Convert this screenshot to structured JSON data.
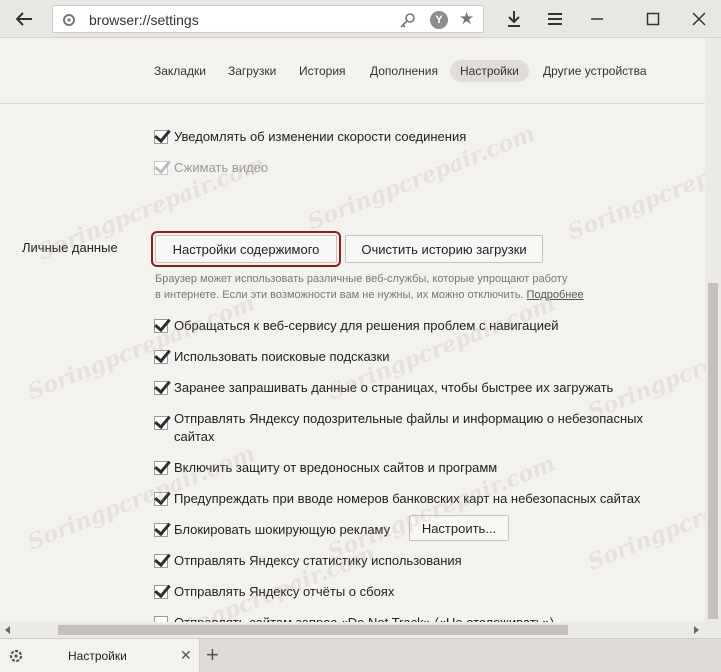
{
  "address_bar": {
    "url": "browser://settings",
    "yandex_badge": "Y"
  },
  "nav_tabs": [
    {
      "label": "Закладки"
    },
    {
      "label": "Загрузки"
    },
    {
      "label": "История"
    },
    {
      "label": "Дополнения"
    },
    {
      "label": "Настройки",
      "active": true
    },
    {
      "label": "Другие устройства"
    }
  ],
  "top_options": [
    {
      "label": "Уведомлять об изменении скорости соединения",
      "checked": true,
      "disabled": false
    },
    {
      "label": "Сжимать видео",
      "checked": true,
      "disabled": true
    }
  ],
  "personal_data": {
    "title": "Личные данные",
    "content_settings_button": "Настройки содержимого",
    "clear_history_button": "Очистить историю загрузки",
    "description_line1": "Браузер может использовать различные веб-службы, которые упрощают работу",
    "description_line2": "в интернете. Если эти возможности вам не нужны, их можно отключить.",
    "more_link": "Подробнее"
  },
  "options": [
    {
      "label": "Обращаться к веб-сервису для решения проблем с навигацией",
      "checked": true
    },
    {
      "label": "Использовать поисковые подсказки",
      "checked": true
    },
    {
      "label": "Заранее запрашивать данные о страницах, чтобы быстрее их загружать",
      "checked": true
    },
    {
      "label": "Отправлять Яндексу подозрительные файлы и информацию о небезопасных",
      "label2": "сайтах",
      "checked": true
    },
    {
      "label": "Включить защиту от вредоносных сайтов и программ",
      "checked": true
    },
    {
      "label": "Предупреждать при вводе номеров банковских карт на небезопасных сайтах",
      "checked": true
    },
    {
      "label": "Блокировать шокирующую рекламу",
      "checked": true,
      "button": "Настроить..."
    },
    {
      "label": "Отправлять Яндексу статистику использования",
      "checked": true
    },
    {
      "label": "Отправлять Яндексу отчёты о сбоях",
      "checked": true
    },
    {
      "label": "Отправлять сайтам запрос «Do Not Track» («Не отслеживать»)",
      "checked": false
    }
  ],
  "tab_strip": {
    "active_tab_title": "Настройки"
  },
  "watermark": "Soringpcrepair.com",
  "colors": {
    "highlight_outline": "#8a1f1f",
    "background": "#f4f2ef"
  }
}
